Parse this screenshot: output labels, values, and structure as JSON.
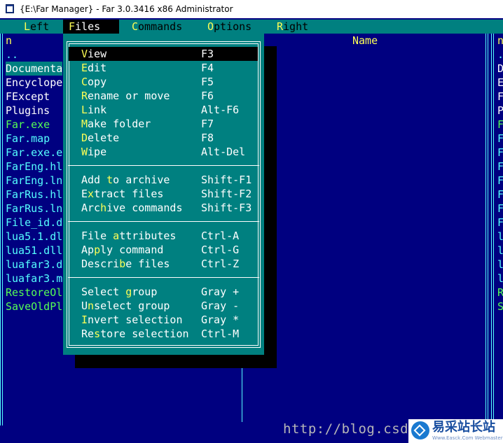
{
  "window": {
    "title": "{E:\\Far Manager} - Far 3.0.3416 x86 Administrator",
    "icon": "far-app-icon"
  },
  "menubar": [
    {
      "pre": "",
      "hk": "L",
      "post": "eft"
    },
    {
      "pre": "",
      "hk": "F",
      "post": "iles"
    },
    {
      "pre": "",
      "hk": "C",
      "post": "ommands"
    },
    {
      "pre": "",
      "hk": "O",
      "post": "ptions"
    },
    {
      "pre": "",
      "hk": "R",
      "post": "ight"
    }
  ],
  "left_panel": {
    "header": "n",
    "files": [
      {
        "name": "..",
        "color": "cyan"
      },
      {
        "name": "Documenta",
        "color": "white",
        "selected": true
      },
      {
        "name": "Encyclope",
        "color": "white"
      },
      {
        "name": "FExcept",
        "color": "white"
      },
      {
        "name": "Plugins",
        "color": "white"
      },
      {
        "name": "Far.exe",
        "color": "green"
      },
      {
        "name": "Far.map",
        "color": "cyan"
      },
      {
        "name": "Far.exe.e",
        "color": "cyan"
      },
      {
        "name": "FarEng.hl",
        "color": "cyan"
      },
      {
        "name": "FarEng.ln",
        "color": "cyan"
      },
      {
        "name": "FarRus.hl",
        "color": "cyan"
      },
      {
        "name": "FarRus.ln",
        "color": "cyan"
      },
      {
        "name": "File_id.d",
        "color": "cyan"
      },
      {
        "name": "lua5.1.dl",
        "color": "cyan"
      },
      {
        "name": "lua51.dll",
        "color": "cyan"
      },
      {
        "name": "luafar3.d",
        "color": "cyan"
      },
      {
        "name": "luafar3.m",
        "color": "cyan"
      },
      {
        "name": "RestoreOl",
        "color": "green"
      },
      {
        "name": "SaveOldPl",
        "color": "green"
      }
    ],
    "name_header": "Name"
  },
  "right_panel": {
    "header": "n",
    "letters": [
      {
        "t": ".",
        "color": "cyan"
      },
      {
        "t": "D",
        "color": "white"
      },
      {
        "t": "E",
        "color": "white"
      },
      {
        "t": "F",
        "color": "white"
      },
      {
        "t": "P",
        "color": "white"
      },
      {
        "t": "F",
        "color": "green"
      },
      {
        "t": "F",
        "color": "cyan"
      },
      {
        "t": "F",
        "color": "cyan"
      },
      {
        "t": "F",
        "color": "cyan"
      },
      {
        "t": "F",
        "color": "cyan"
      },
      {
        "t": "F",
        "color": "cyan"
      },
      {
        "t": "F",
        "color": "cyan"
      },
      {
        "t": "F",
        "color": "cyan"
      },
      {
        "t": "l",
        "color": "cyan"
      },
      {
        "t": "l",
        "color": "cyan"
      },
      {
        "t": "l",
        "color": "cyan"
      },
      {
        "t": "l",
        "color": "cyan"
      },
      {
        "t": "R",
        "color": "green"
      },
      {
        "t": "S",
        "color": "green"
      }
    ]
  },
  "files_menu": {
    "groups": [
      [
        {
          "pre": "",
          "hk": "V",
          "post": "iew",
          "key": "F3",
          "active": true
        },
        {
          "pre": "",
          "hk": "E",
          "post": "dit",
          "key": "F4"
        },
        {
          "pre": "",
          "hk": "C",
          "post": "opy",
          "key": "F5"
        },
        {
          "pre": "",
          "hk": "R",
          "post": "ename or move",
          "key": "F6"
        },
        {
          "pre": "",
          "hk": "L",
          "post": "ink",
          "key": "Alt-F6"
        },
        {
          "pre": "",
          "hk": "M",
          "post": "ake folder",
          "key": "F7"
        },
        {
          "pre": "",
          "hk": "D",
          "post": "elete",
          "key": "F8"
        },
        {
          "pre": "",
          "hk": "W",
          "post": "ipe",
          "key": "Alt-Del"
        }
      ],
      [
        {
          "pre": "Add ",
          "hk": "t",
          "post": "o archive",
          "key": "Shift-F1"
        },
        {
          "pre": "E",
          "hk": "x",
          "post": "tract files",
          "key": "Shift-F2"
        },
        {
          "pre": "Arc",
          "hk": "h",
          "post": "ive commands",
          "key": "Shift-F3"
        }
      ],
      [
        {
          "pre": "File ",
          "hk": "a",
          "post": "ttributes",
          "key": "Ctrl-A"
        },
        {
          "pre": "Ap",
          "hk": "p",
          "post": "ly command",
          "key": "Ctrl-G"
        },
        {
          "pre": "Descri",
          "hk": "b",
          "post": "e files",
          "key": "Ctrl-Z"
        }
      ],
      [
        {
          "pre": "Select ",
          "hk": "g",
          "post": "roup",
          "key": "Gray +"
        },
        {
          "pre": "U",
          "hk": "n",
          "post": "select group",
          "key": "Gray -"
        },
        {
          "pre": "",
          "hk": "I",
          "post": "nvert selection",
          "key": "Gray *"
        },
        {
          "pre": "Re",
          "hk": "s",
          "post": "tore selection",
          "key": "Ctrl-M"
        }
      ]
    ]
  },
  "watermark": {
    "url_text": "http://blog.csdn.n",
    "brand": "易采站长站",
    "brand_sub": "Www.Easck.Com Webmaster"
  },
  "colors": {
    "panel_bg": "#000080",
    "menu_bg": "#008080",
    "hotkey": "#ffff55",
    "border": "#55ffff",
    "exe_green": "#55ff55",
    "file_cyan": "#55ffff"
  }
}
